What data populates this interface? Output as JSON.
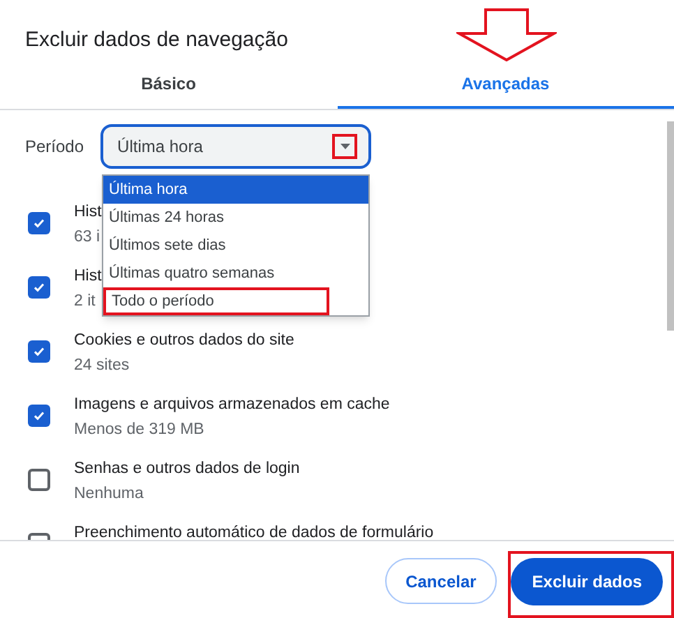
{
  "dialog": {
    "title": "Excluir dados de navegação"
  },
  "tabs": [
    {
      "label": "Básico",
      "selected": false
    },
    {
      "label": "Avançadas",
      "selected": true
    }
  ],
  "period": {
    "label": "Período",
    "value": "Última hora",
    "expanded": true,
    "options": [
      {
        "label": "Última hora",
        "selected": true
      },
      {
        "label": "Últimas 24 horas",
        "selected": false
      },
      {
        "label": "Últimos sete dias",
        "selected": false
      },
      {
        "label": "Últimas quatro semanas",
        "selected": false
      },
      {
        "label": "Todo o período",
        "selected": false
      }
    ]
  },
  "items": [
    {
      "title": "Hist",
      "detail": "63 i",
      "checked": true
    },
    {
      "title": "Hist",
      "detail": "2 it",
      "checked": true
    },
    {
      "title": "Cookies e outros dados do site",
      "detail": "24 sites",
      "checked": true
    },
    {
      "title": "Imagens e arquivos armazenados em cache",
      "detail": "Menos de 319 MB",
      "checked": true
    },
    {
      "title": "Senhas e outros dados de login",
      "detail": "Nenhuma",
      "checked": false
    },
    {
      "title": "Preenchimento automático de dados de formulário",
      "checked": false
    }
  ],
  "buttons": {
    "cancel": "Cancelar",
    "confirm": "Excluir dados"
  }
}
